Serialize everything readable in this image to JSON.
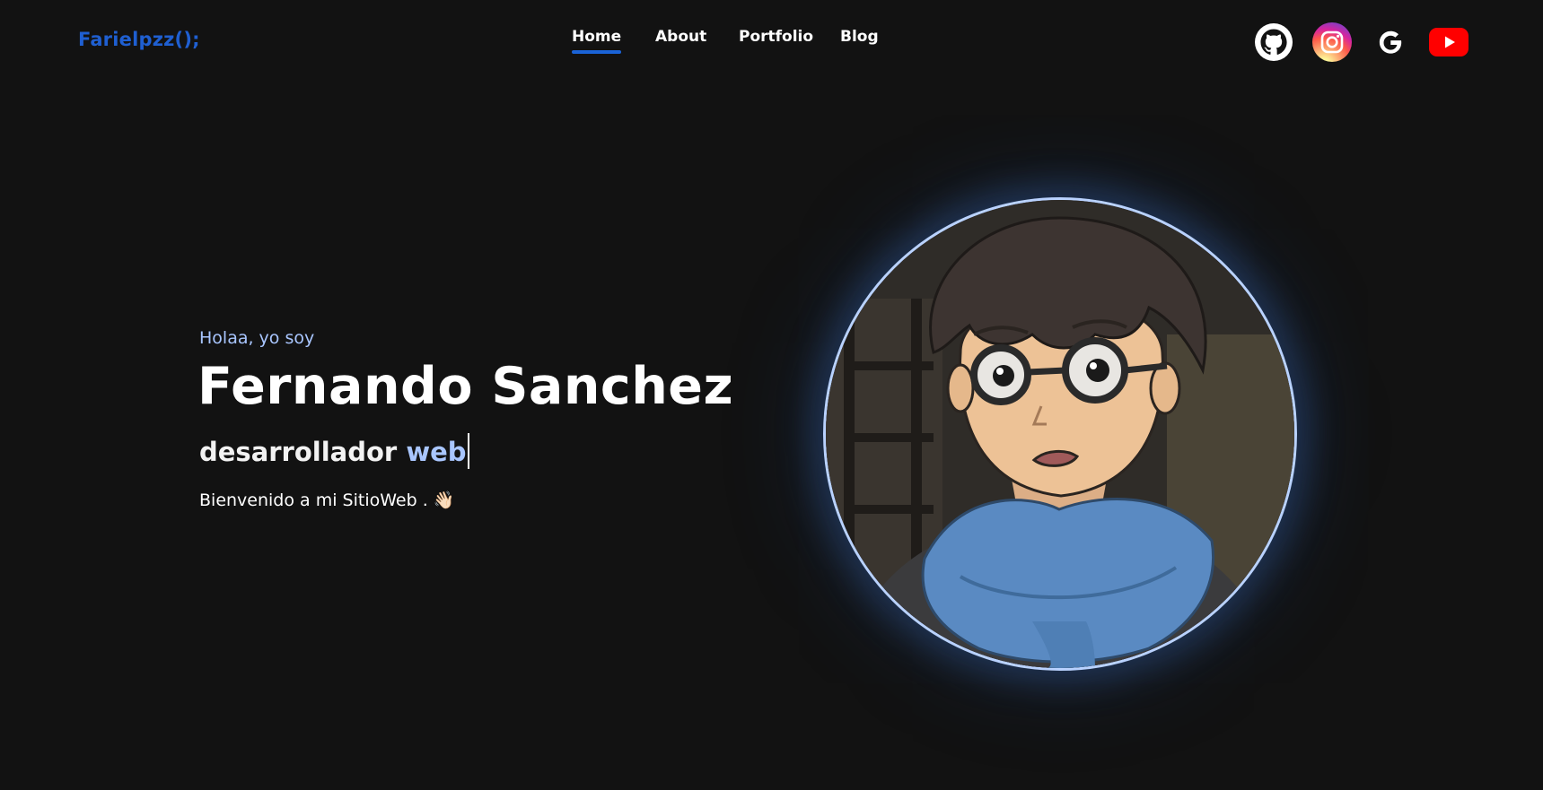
{
  "header": {
    "logo": "Farielpzz();",
    "nav": [
      {
        "label": "Home",
        "active": true
      },
      {
        "label": "About",
        "active": false
      },
      {
        "label": "Portfolio",
        "active": false
      },
      {
        "label": "Blog",
        "active": false
      }
    ],
    "social": [
      {
        "icon": "github-icon"
      },
      {
        "icon": "instagram-icon"
      },
      {
        "icon": "google-icon"
      },
      {
        "icon": "youtube-icon"
      }
    ],
    "accent_color": "#1a63d8"
  },
  "hero": {
    "greeting": "Holaa, yo soy",
    "name": "Fernando Sanchez",
    "role_prefix": "desarrollador ",
    "role_typed": "web",
    "welcome": "Bienvenido a mi SitioWeb .",
    "welcome_emoji": "👋🏻",
    "avatar_icon": "avatar-illustration"
  }
}
